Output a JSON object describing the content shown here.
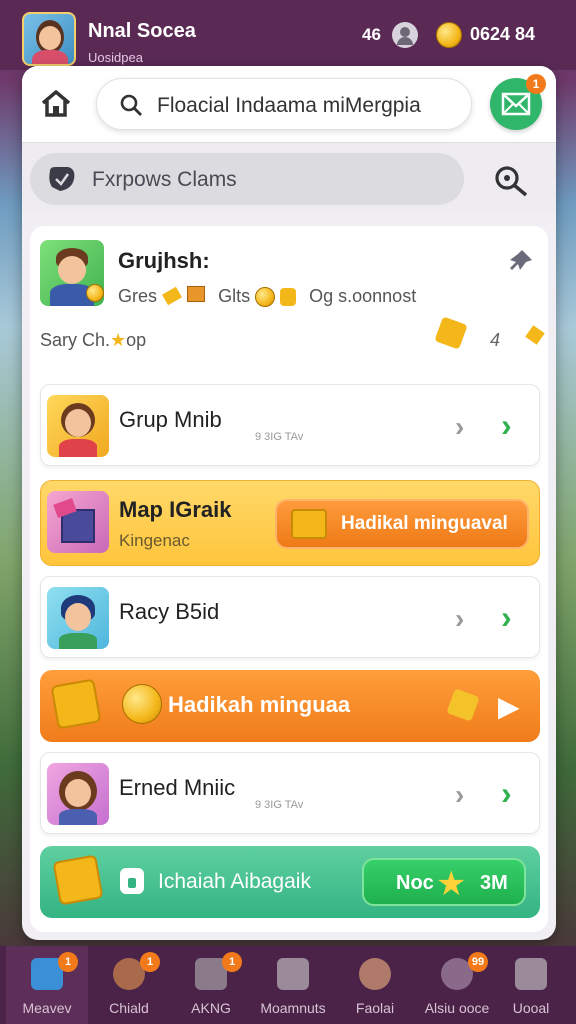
{
  "top": {
    "username": "Nnal Socea",
    "subname": "Uosidpea",
    "level": "46",
    "coins": "0624 84"
  },
  "header": {
    "search_text": "Floacial Indaama miMergpia",
    "mail_badge": "1"
  },
  "filter": {
    "label": "Fxrpows Clams"
  },
  "profile": {
    "name": "Grujhsh:",
    "stats_a": "Gres",
    "stats_b": "Glts",
    "stats_c": "Og s.oonnost",
    "row_label": "Sary Ch.",
    "row_label_b": "op",
    "row_count": "4"
  },
  "rows": [
    {
      "title": "Grup Mnib",
      "sub": "9 3IG TAv"
    },
    {
      "title": "Racy B5id",
      "sub": ""
    },
    {
      "title": "Erned Mniic",
      "sub": "9 3IG TAv"
    }
  ],
  "promo_yellow": {
    "title": "Map IGraik",
    "sub": "Kingenac",
    "button": "Hadikal minguaval"
  },
  "promo_orange": {
    "text": "Hadikah minguaa"
  },
  "promo_green": {
    "text": "Ichaiah Aibagaik",
    "button_a": "Noc",
    "button_b": "3M"
  },
  "nav": [
    {
      "label": "Meavev",
      "badge": "1",
      "icon": "home-icon"
    },
    {
      "label": "Chiald",
      "badge": "1",
      "icon": "avatar-icon"
    },
    {
      "label": "AKNG",
      "badge": "1",
      "icon": "camera-icon"
    },
    {
      "label": "Moamnuts",
      "badge": "",
      "icon": "phone-icon"
    },
    {
      "label": "Faolai",
      "badge": "",
      "icon": "face-icon"
    },
    {
      "label": "Alsiu ooce",
      "badge": "99",
      "icon": "globe-icon"
    },
    {
      "label": "Uooal",
      "badge": "",
      "icon": "lock-icon"
    }
  ],
  "colors": {
    "accent_green": "#2fb66b",
    "badge_orange": "#f27a1a",
    "nav_bg": "#4c2348"
  }
}
